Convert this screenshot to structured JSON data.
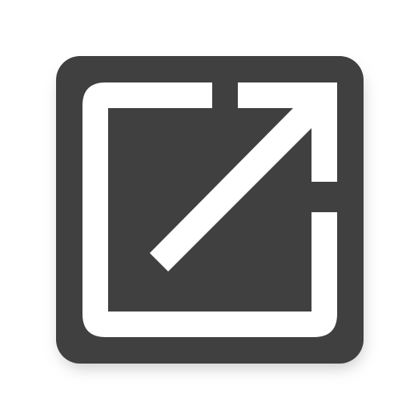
{
  "icon": {
    "name": "open-in-new-icon",
    "tile_color": "#404040",
    "glyph_color": "#ffffff",
    "shadow_color": "#bdbdbd",
    "background_color": "#ffffff"
  }
}
